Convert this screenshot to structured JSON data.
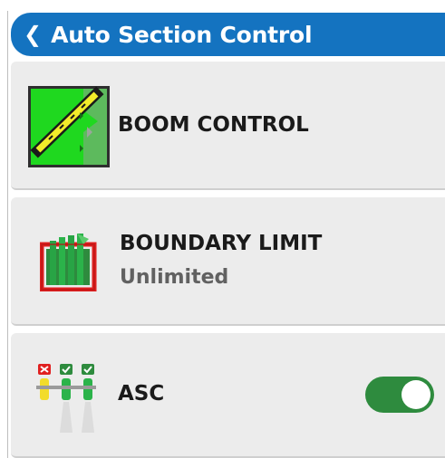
{
  "header": {
    "title": "Auto Section Control",
    "accent_color": "#1473c0"
  },
  "rows": [
    {
      "label": "BOOM CONTROL",
      "icon": "boom-control-icon"
    },
    {
      "label": "BOUNDARY LIMIT",
      "value": "Unlimited",
      "icon": "boundary-limit-icon"
    },
    {
      "label": "ASC",
      "icon": "asc-sections-icon",
      "toggle_on": true,
      "toggle_color": "#2e8b3e"
    }
  ]
}
